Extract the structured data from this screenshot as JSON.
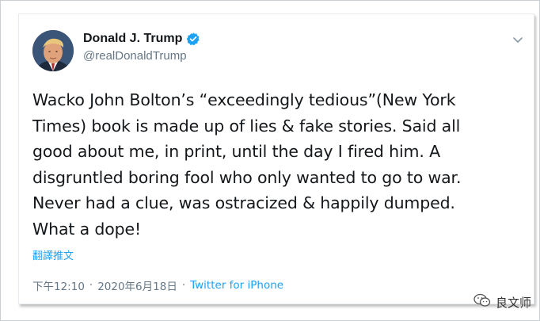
{
  "tweet": {
    "display_name": "Donald J. Trump",
    "handle": "@realDonaldTrump",
    "verified_icon": "verified-badge-icon",
    "menu_icon": "chevron-down-icon",
    "text_lines": [
      "Wacko John Bolton’s “exceedingly tedious”(New York",
      "Times) book is made up of lies & fake stories. Said all",
      "good about me, in print, until the day I fired him. A",
      "disgruntled boring fool who only wanted to go to war.",
      "Never had a clue, was ostracized & happily dumped.",
      "What a dope!"
    ],
    "translate_label": "翻譯推文",
    "time": "下午12:10",
    "separator": "·",
    "date": "2020年6月18日",
    "source": "Twitter for iPhone"
  },
  "watermark": {
    "icon": "wechat-icon",
    "text": "良文师"
  },
  "colors": {
    "accent": "#1da1f2",
    "text": "#14171a",
    "muted": "#657786"
  }
}
